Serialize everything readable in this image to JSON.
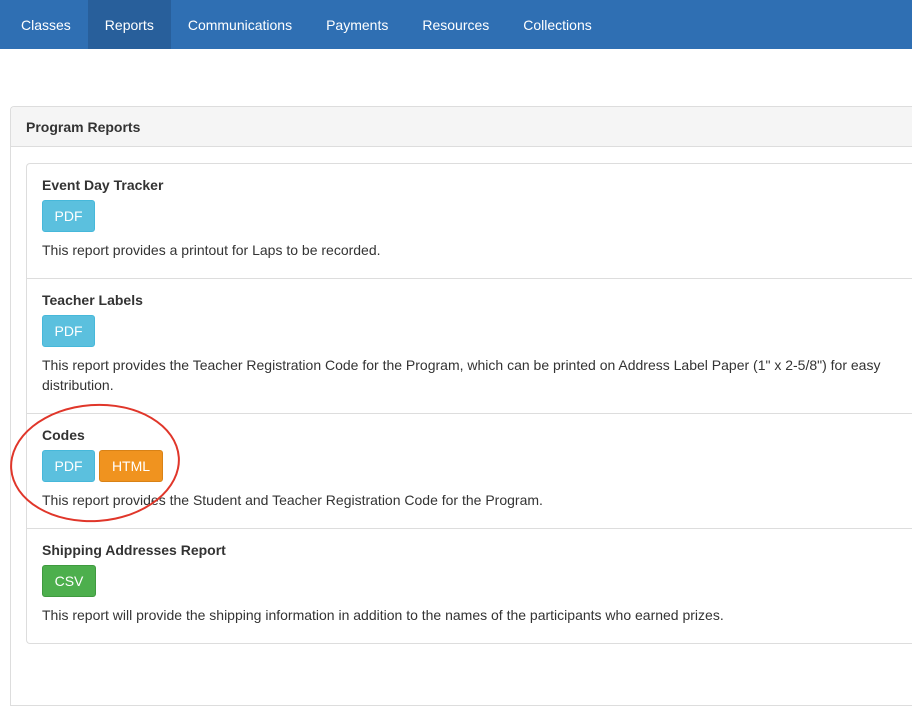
{
  "nav": {
    "items": [
      {
        "label": "Classes",
        "active": false
      },
      {
        "label": "Reports",
        "active": true
      },
      {
        "label": "Communications",
        "active": false
      },
      {
        "label": "Payments",
        "active": false
      },
      {
        "label": "Resources",
        "active": false
      },
      {
        "label": "Collections",
        "active": false
      }
    ]
  },
  "panel": {
    "title": "Program Reports"
  },
  "reports": [
    {
      "title": "Event Day Tracker",
      "buttons": [
        "PDF"
      ],
      "description": "This report provides a printout for Laps to be recorded."
    },
    {
      "title": "Teacher Labels",
      "buttons": [
        "PDF"
      ],
      "description": "This report provides the Teacher Registration Code for the Program, which can be printed on Address Label Paper (1\" x 2-5/8\") for easy distribution."
    },
    {
      "title": "Codes",
      "buttons": [
        "PDF",
        "HTML"
      ],
      "description": "This report provides the Student and Teacher Registration Code for the Program."
    },
    {
      "title": "Shipping Addresses Report",
      "buttons": [
        "CSV"
      ],
      "description": "This report will provide the shipping information in addition to the names of the participants who earned prizes."
    }
  ],
  "colors": {
    "navbar": "#2f6fb3",
    "pdf_button": "#5bc0de",
    "html_button": "#f0931f",
    "csv_button": "#4daf4d",
    "highlight": "#e0362a"
  }
}
